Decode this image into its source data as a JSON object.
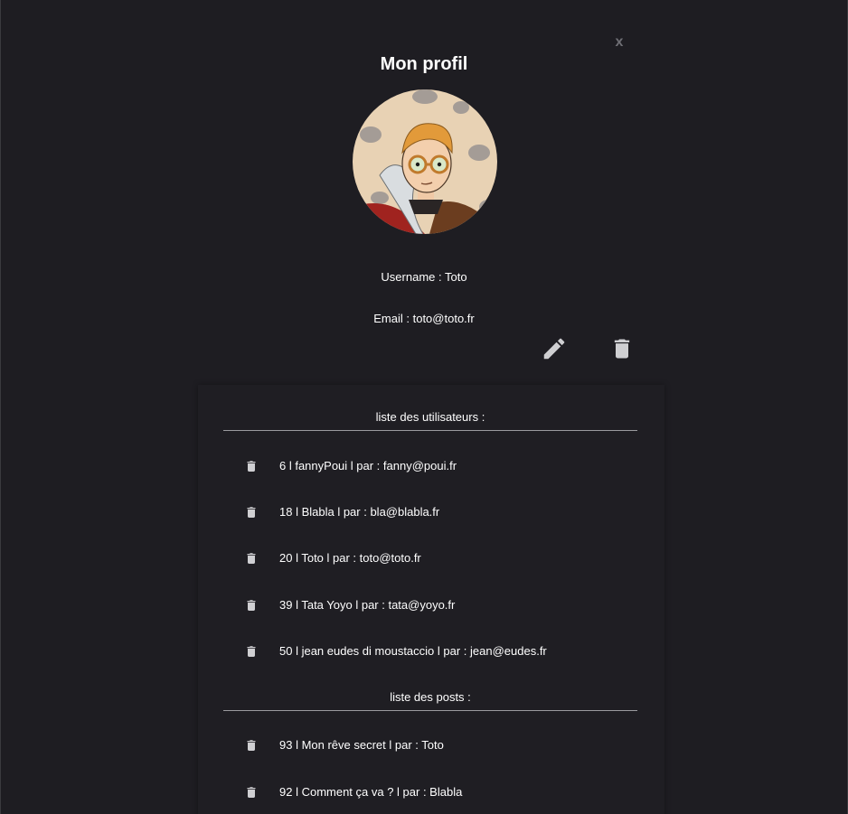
{
  "profile": {
    "title": "Mon profil",
    "close_label": "x",
    "username_line": "Username : Toto",
    "email_line": "Email : toto@toto.fr",
    "avatar_icon": "profile-avatar-illustration",
    "edit_icon": "pencil-icon",
    "delete_icon": "trash-icon"
  },
  "users_section": {
    "header": "liste des utilisateurs :",
    "items": [
      {
        "text": "6 l fannyPoui l par : fanny@poui.fr"
      },
      {
        "text": "18 l Blabla l par : bla@blabla.fr"
      },
      {
        "text": "20 l Toto l par : toto@toto.fr"
      },
      {
        "text": "39 l Tata Yoyo l par : tata@yoyo.fr"
      },
      {
        "text": "50 l jean eudes di moustaccio l par : jean@eudes.fr"
      }
    ]
  },
  "posts_section": {
    "header": "liste des posts :",
    "items": [
      {
        "text": "93 l Mon rêve secret l par : Toto"
      },
      {
        "text": "92 l Comment ça va ? l par : Blabla"
      }
    ]
  },
  "colors": {
    "background": "#1e1d22",
    "text": "#ffffff",
    "icon": "#cfcfd2",
    "close": "#6f6f75",
    "divider": "#9a9a9e"
  }
}
